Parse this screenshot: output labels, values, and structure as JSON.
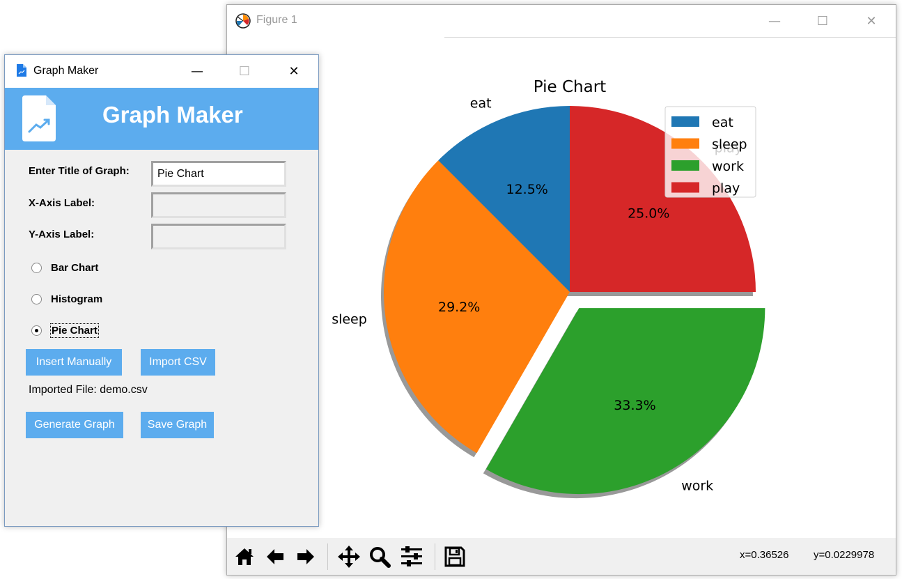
{
  "graph_maker": {
    "window_title": "Graph Maker",
    "heading": "Graph Maker",
    "title_label": "Enter Title of Graph:",
    "title_value": "Pie Chart",
    "x_label": "X-Axis Label:",
    "x_value": "",
    "y_label": "Y-Axis Label:",
    "y_value": "",
    "chart_types": [
      {
        "label": "Bar Chart",
        "selected": false
      },
      {
        "label": "Histogram",
        "selected": false
      },
      {
        "label": "Pie Chart",
        "selected": true
      }
    ],
    "insert_manually": "Insert Manually",
    "import_csv": "Import CSV",
    "imported_file": "Imported File: demo.csv",
    "generate_graph": "Generate Graph",
    "save_graph": "Save Graph",
    "accent_color": "#5cacee"
  },
  "figure": {
    "window_title": "Figure 1",
    "coord_x": "x=0.36526",
    "coord_y": "y=0.0229978",
    "toolbar_icons": [
      "home-icon",
      "back-arrow-icon",
      "forward-arrow-icon",
      "pan-icon",
      "zoom-icon",
      "configure-subplots-icon",
      "save-icon"
    ]
  },
  "chart_data": {
    "type": "pie",
    "title": "Pie Chart",
    "categories": [
      "eat",
      "sleep",
      "work",
      "play"
    ],
    "values": [
      3,
      7,
      8,
      6
    ],
    "percent_labels": [
      "12.5%",
      "29.2%",
      "33.3%",
      "25.0%"
    ],
    "colors": [
      "#1f77b4",
      "#ff7f0e",
      "#2ca02c",
      "#d62728"
    ],
    "explode": [
      0,
      0,
      0.1,
      0
    ],
    "shadow": true,
    "start_angle": 90,
    "legend_placement": "top-right"
  },
  "window_controls": {
    "minimize": "—",
    "maximize": "☐",
    "close": "✕"
  }
}
